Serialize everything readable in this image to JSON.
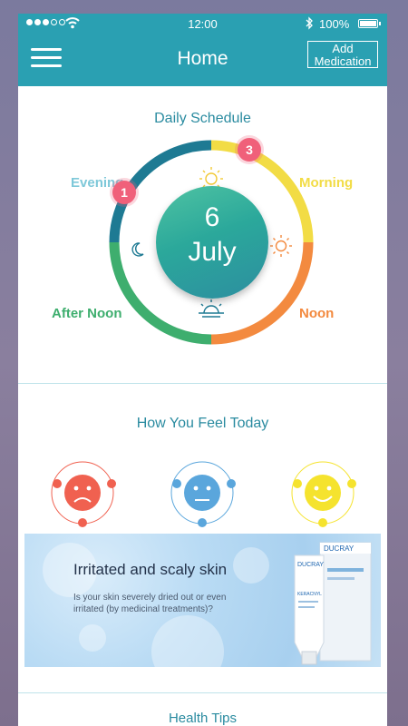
{
  "status_bar": {
    "time": "12:00",
    "battery": "100%"
  },
  "nav": {
    "title": "Home",
    "add_button_line1": "Add",
    "add_button_line2": "Medication"
  },
  "schedule": {
    "title": "Daily Schedule",
    "day": "6",
    "month": "July",
    "labels": {
      "evening": "Evening",
      "morning": "Morning",
      "afternoon": "After Noon",
      "noon": "Noon"
    },
    "badges": {
      "evening": "1",
      "morning": "3"
    },
    "colors": {
      "evening": "#1e7a93",
      "morning": "#f2dc45",
      "noon": "#f38a3f",
      "afternoon": "#3eae6e",
      "evening_label": "#7ec8d9"
    },
    "icons": [
      "moon-icon",
      "sunrise-icon",
      "sun-icon",
      "sunset-icon"
    ]
  },
  "mood": {
    "title": "How You Feel Today",
    "options": [
      {
        "name": "sad",
        "color": "#f06150"
      },
      {
        "name": "neutral",
        "color": "#5aa6dc"
      },
      {
        "name": "happy",
        "color": "#f5e32e"
      }
    ]
  },
  "ad": {
    "title": "Irritated and scaly skin",
    "text": "Is your skin severely dried out or even irritated (by medicinal treatments)?",
    "brand": "DUCRAY",
    "product": "KERACNYL"
  },
  "tips": {
    "title": "Health Tips"
  }
}
